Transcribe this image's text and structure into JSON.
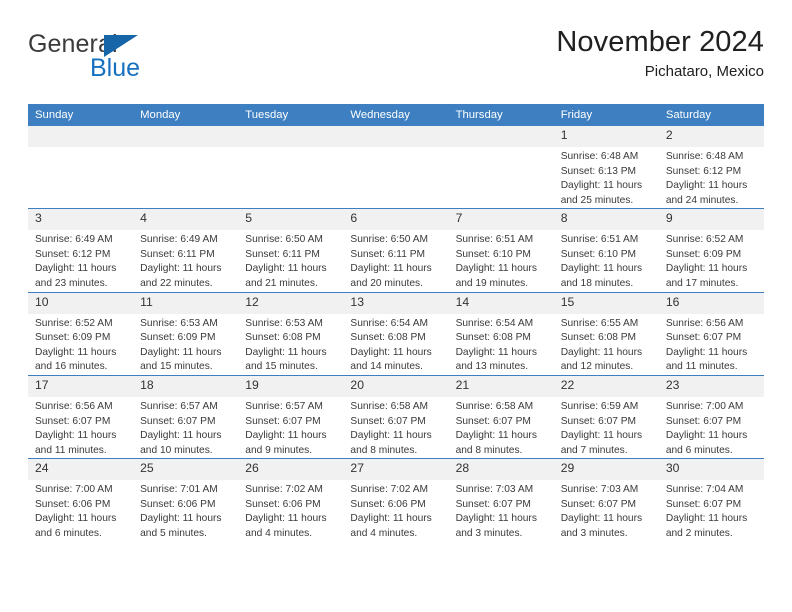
{
  "brand": {
    "name_part1": "General",
    "name_part2": "Blue",
    "accent_color": "#1771c0",
    "triangle_color": "#1565a8"
  },
  "header": {
    "title": "November 2024",
    "subtitle": "Pichataro, Mexico"
  },
  "theme": {
    "header_row_bg": "#3d7fc1",
    "daynum_bg": "#f1f1f1",
    "grid_line": "#3d7fc1",
    "text": "#333333"
  },
  "calendar": {
    "weekday_headers": [
      "Sunday",
      "Monday",
      "Tuesday",
      "Wednesday",
      "Thursday",
      "Friday",
      "Saturday"
    ],
    "weeks": [
      [
        {
          "day": "",
          "blank": true
        },
        {
          "day": "",
          "blank": true
        },
        {
          "day": "",
          "blank": true
        },
        {
          "day": "",
          "blank": true
        },
        {
          "day": "",
          "blank": true
        },
        {
          "day": "1",
          "sunrise": "Sunrise: 6:48 AM",
          "sunset": "Sunset: 6:13 PM",
          "daylight_line1": "Daylight: 11 hours",
          "daylight_line2": "and 25 minutes."
        },
        {
          "day": "2",
          "sunrise": "Sunrise: 6:48 AM",
          "sunset": "Sunset: 6:12 PM",
          "daylight_line1": "Daylight: 11 hours",
          "daylight_line2": "and 24 minutes."
        }
      ],
      [
        {
          "day": "3",
          "sunrise": "Sunrise: 6:49 AM",
          "sunset": "Sunset: 6:12 PM",
          "daylight_line1": "Daylight: 11 hours",
          "daylight_line2": "and 23 minutes."
        },
        {
          "day": "4",
          "sunrise": "Sunrise: 6:49 AM",
          "sunset": "Sunset: 6:11 PM",
          "daylight_line1": "Daylight: 11 hours",
          "daylight_line2": "and 22 minutes."
        },
        {
          "day": "5",
          "sunrise": "Sunrise: 6:50 AM",
          "sunset": "Sunset: 6:11 PM",
          "daylight_line1": "Daylight: 11 hours",
          "daylight_line2": "and 21 minutes."
        },
        {
          "day": "6",
          "sunrise": "Sunrise: 6:50 AM",
          "sunset": "Sunset: 6:11 PM",
          "daylight_line1": "Daylight: 11 hours",
          "daylight_line2": "and 20 minutes."
        },
        {
          "day": "7",
          "sunrise": "Sunrise: 6:51 AM",
          "sunset": "Sunset: 6:10 PM",
          "daylight_line1": "Daylight: 11 hours",
          "daylight_line2": "and 19 minutes."
        },
        {
          "day": "8",
          "sunrise": "Sunrise: 6:51 AM",
          "sunset": "Sunset: 6:10 PM",
          "daylight_line1": "Daylight: 11 hours",
          "daylight_line2": "and 18 minutes."
        },
        {
          "day": "9",
          "sunrise": "Sunrise: 6:52 AM",
          "sunset": "Sunset: 6:09 PM",
          "daylight_line1": "Daylight: 11 hours",
          "daylight_line2": "and 17 minutes."
        }
      ],
      [
        {
          "day": "10",
          "sunrise": "Sunrise: 6:52 AM",
          "sunset": "Sunset: 6:09 PM",
          "daylight_line1": "Daylight: 11 hours",
          "daylight_line2": "and 16 minutes."
        },
        {
          "day": "11",
          "sunrise": "Sunrise: 6:53 AM",
          "sunset": "Sunset: 6:09 PM",
          "daylight_line1": "Daylight: 11 hours",
          "daylight_line2": "and 15 minutes."
        },
        {
          "day": "12",
          "sunrise": "Sunrise: 6:53 AM",
          "sunset": "Sunset: 6:08 PM",
          "daylight_line1": "Daylight: 11 hours",
          "daylight_line2": "and 15 minutes."
        },
        {
          "day": "13",
          "sunrise": "Sunrise: 6:54 AM",
          "sunset": "Sunset: 6:08 PM",
          "daylight_line1": "Daylight: 11 hours",
          "daylight_line2": "and 14 minutes."
        },
        {
          "day": "14",
          "sunrise": "Sunrise: 6:54 AM",
          "sunset": "Sunset: 6:08 PM",
          "daylight_line1": "Daylight: 11 hours",
          "daylight_line2": "and 13 minutes."
        },
        {
          "day": "15",
          "sunrise": "Sunrise: 6:55 AM",
          "sunset": "Sunset: 6:08 PM",
          "daylight_line1": "Daylight: 11 hours",
          "daylight_line2": "and 12 minutes."
        },
        {
          "day": "16",
          "sunrise": "Sunrise: 6:56 AM",
          "sunset": "Sunset: 6:07 PM",
          "daylight_line1": "Daylight: 11 hours",
          "daylight_line2": "and 11 minutes."
        }
      ],
      [
        {
          "day": "17",
          "sunrise": "Sunrise: 6:56 AM",
          "sunset": "Sunset: 6:07 PM",
          "daylight_line1": "Daylight: 11 hours",
          "daylight_line2": "and 11 minutes."
        },
        {
          "day": "18",
          "sunrise": "Sunrise: 6:57 AM",
          "sunset": "Sunset: 6:07 PM",
          "daylight_line1": "Daylight: 11 hours",
          "daylight_line2": "and 10 minutes."
        },
        {
          "day": "19",
          "sunrise": "Sunrise: 6:57 AM",
          "sunset": "Sunset: 6:07 PM",
          "daylight_line1": "Daylight: 11 hours",
          "daylight_line2": "and 9 minutes."
        },
        {
          "day": "20",
          "sunrise": "Sunrise: 6:58 AM",
          "sunset": "Sunset: 6:07 PM",
          "daylight_line1": "Daylight: 11 hours",
          "daylight_line2": "and 8 minutes."
        },
        {
          "day": "21",
          "sunrise": "Sunrise: 6:58 AM",
          "sunset": "Sunset: 6:07 PM",
          "daylight_line1": "Daylight: 11 hours",
          "daylight_line2": "and 8 minutes."
        },
        {
          "day": "22",
          "sunrise": "Sunrise: 6:59 AM",
          "sunset": "Sunset: 6:07 PM",
          "daylight_line1": "Daylight: 11 hours",
          "daylight_line2": "and 7 minutes."
        },
        {
          "day": "23",
          "sunrise": "Sunrise: 7:00 AM",
          "sunset": "Sunset: 6:07 PM",
          "daylight_line1": "Daylight: 11 hours",
          "daylight_line2": "and 6 minutes."
        }
      ],
      [
        {
          "day": "24",
          "sunrise": "Sunrise: 7:00 AM",
          "sunset": "Sunset: 6:06 PM",
          "daylight_line1": "Daylight: 11 hours",
          "daylight_line2": "and 6 minutes."
        },
        {
          "day": "25",
          "sunrise": "Sunrise: 7:01 AM",
          "sunset": "Sunset: 6:06 PM",
          "daylight_line1": "Daylight: 11 hours",
          "daylight_line2": "and 5 minutes."
        },
        {
          "day": "26",
          "sunrise": "Sunrise: 7:02 AM",
          "sunset": "Sunset: 6:06 PM",
          "daylight_line1": "Daylight: 11 hours",
          "daylight_line2": "and 4 minutes."
        },
        {
          "day": "27",
          "sunrise": "Sunrise: 7:02 AM",
          "sunset": "Sunset: 6:06 PM",
          "daylight_line1": "Daylight: 11 hours",
          "daylight_line2": "and 4 minutes."
        },
        {
          "day": "28",
          "sunrise": "Sunrise: 7:03 AM",
          "sunset": "Sunset: 6:07 PM",
          "daylight_line1": "Daylight: 11 hours",
          "daylight_line2": "and 3 minutes."
        },
        {
          "day": "29",
          "sunrise": "Sunrise: 7:03 AM",
          "sunset": "Sunset: 6:07 PM",
          "daylight_line1": "Daylight: 11 hours",
          "daylight_line2": "and 3 minutes."
        },
        {
          "day": "30",
          "sunrise": "Sunrise: 7:04 AM",
          "sunset": "Sunset: 6:07 PM",
          "daylight_line1": "Daylight: 11 hours",
          "daylight_line2": "and 2 minutes."
        }
      ]
    ]
  }
}
